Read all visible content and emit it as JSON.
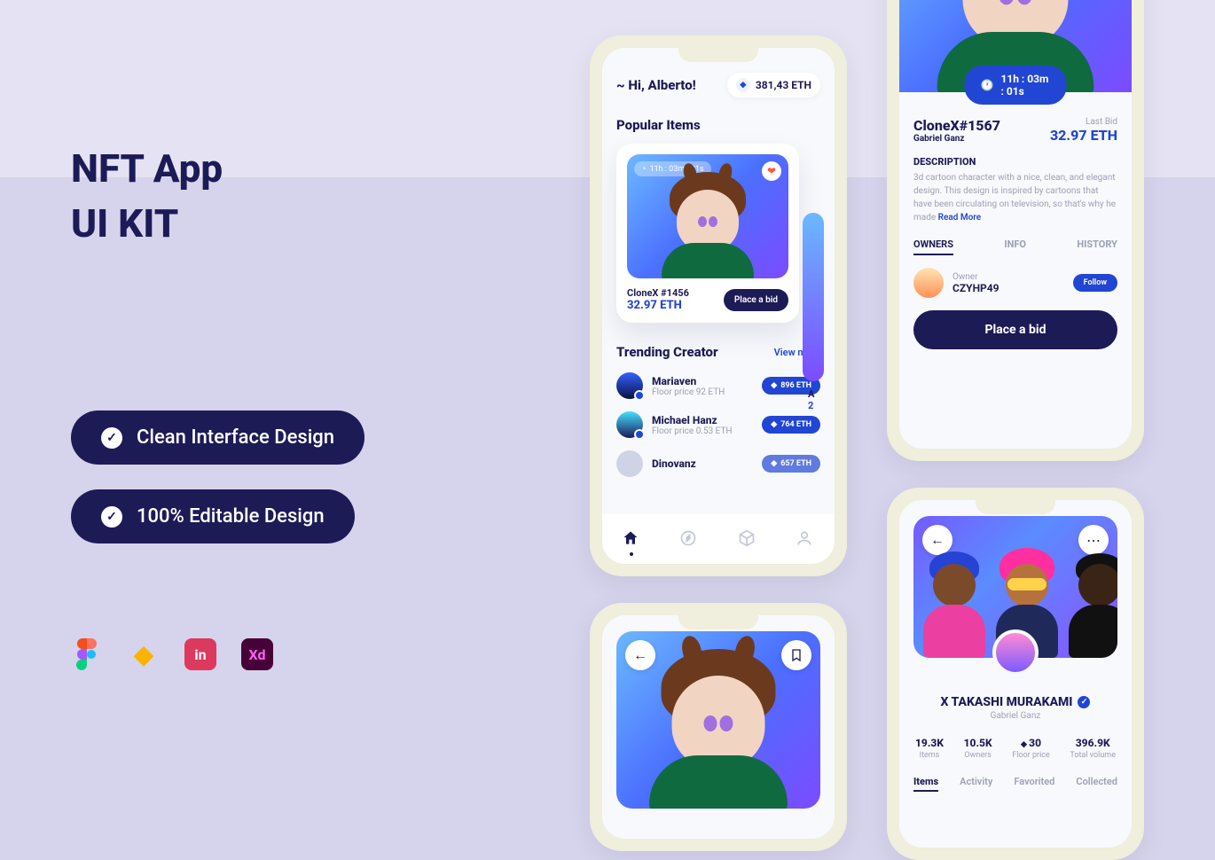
{
  "marketing": {
    "title_line1": "NFT App",
    "title_line2": "UI KIT",
    "pill1": "Clean Interface Design",
    "pill2": "100% Editable Design",
    "tools": {
      "figma": "Figma",
      "sketch": "Sketch",
      "invision": "in",
      "xd": "Xd"
    }
  },
  "home": {
    "greeting": "~ Hi, Alberto!",
    "balance": "381,43 ETH",
    "popular_heading": "Popular Items",
    "card_timer": "11h : 03m : 01s",
    "card_title": "CloneX #1456",
    "card_price": "32.97 ETH",
    "bid_btn": "Place a bid",
    "next_card_letter": "A",
    "next_card_price_first": "2",
    "trending_heading": "Trending Creator",
    "view_more": "View more",
    "creators": [
      {
        "name": "Mariaven",
        "sub": "Floor price 92 ETH",
        "price": "896 ETH"
      },
      {
        "name": "Michael Hanz",
        "sub": "Floor price 0.53 ETH",
        "price": "764 ETH"
      },
      {
        "name": "Dinovanz",
        "sub": "",
        "price": "657 ETH"
      }
    ]
  },
  "detail": {
    "timer": "11h : 03m : 01s",
    "name": "CloneX#1567",
    "creator": "Gabriel Ganz",
    "last_bid_label": "Last Bid",
    "last_bid_value": "32.97 ETH",
    "desc_heading": "DESCRIPTION",
    "desc_text": "3d cartoon character with a nice, clean, and elegant design. This design is inspired by cartoons that have been circulating on television, so that's why he made ",
    "read_more": "Read More",
    "tabs": {
      "owners": "OWNERS",
      "info": "INFO",
      "history": "HISTORY"
    },
    "owner_label": "Owner",
    "owner_name": "CZYHP49",
    "follow": "Follow",
    "bid_btn": "Place a bid"
  },
  "profile": {
    "name": "X TAKASHI MURAKAMI",
    "sub": "Gabriel Ganz",
    "stats": [
      {
        "v": "19.3K",
        "l": "Items"
      },
      {
        "v": "10.5K",
        "l": "Owners"
      },
      {
        "v": "30",
        "l": "Floor price",
        "eth": true
      },
      {
        "v": "396.9K",
        "l": "Total volume"
      }
    ],
    "tabs": {
      "items": "Items",
      "activity": "Activity",
      "favorited": "Favorited",
      "collected": "Collected"
    }
  }
}
